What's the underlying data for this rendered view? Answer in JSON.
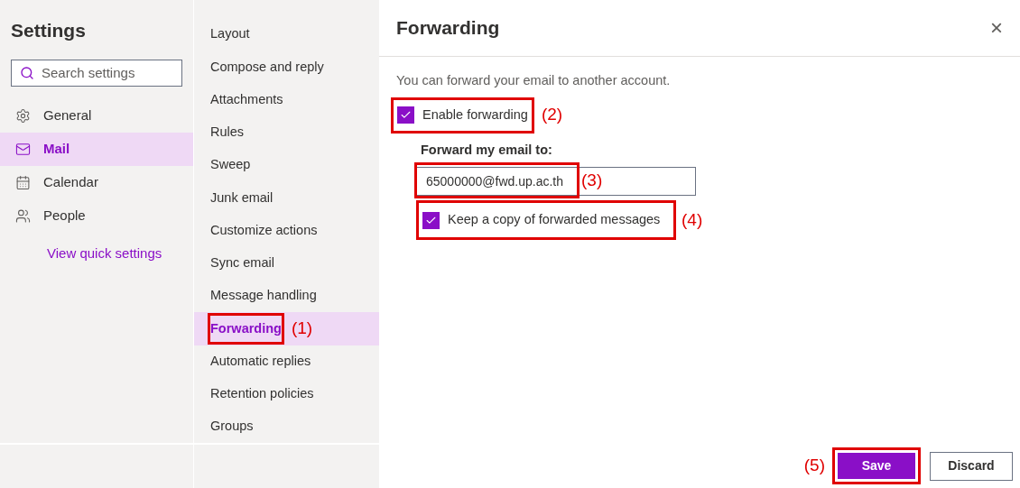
{
  "sidebar": {
    "title": "Settings",
    "search": {
      "placeholder": "Search settings"
    },
    "items": [
      {
        "kind": "gear",
        "label": "General",
        "selected": false
      },
      {
        "kind": "mail",
        "label": "Mail",
        "selected": true
      },
      {
        "kind": "calendar",
        "label": "Calendar",
        "selected": false
      },
      {
        "kind": "people",
        "label": "People",
        "selected": false
      }
    ],
    "link": "View quick settings"
  },
  "submenu": {
    "items": [
      {
        "label": "Layout",
        "selected": false
      },
      {
        "label": "Compose and reply",
        "selected": false
      },
      {
        "label": "Attachments",
        "selected": false
      },
      {
        "label": "Rules",
        "selected": false
      },
      {
        "label": "Sweep",
        "selected": false
      },
      {
        "label": "Junk email",
        "selected": false
      },
      {
        "label": "Customize actions",
        "selected": false
      },
      {
        "label": "Sync email",
        "selected": false
      },
      {
        "label": "Message handling",
        "selected": false
      },
      {
        "label": "Forwarding",
        "selected": true,
        "callout": "(1)"
      },
      {
        "label": "Automatic replies",
        "selected": false
      },
      {
        "label": "Retention policies",
        "selected": false
      },
      {
        "label": "Groups",
        "selected": false
      }
    ]
  },
  "panel": {
    "title": "Forwarding",
    "close": "×",
    "description": "You can forward your email to another account.",
    "enable": {
      "label": "Enable forwarding",
      "checked": true,
      "callout": "(2)"
    },
    "address_label": "Forward my email to:",
    "address": {
      "value": "65000000@fwd.up.ac.th",
      "callout": "(3)"
    },
    "keep_copy": {
      "label": "Keep a copy of forwarded messages",
      "checked": true,
      "callout": "(4)"
    },
    "save": {
      "label": "Save",
      "callout": "(5)"
    },
    "discard": "Discard"
  }
}
